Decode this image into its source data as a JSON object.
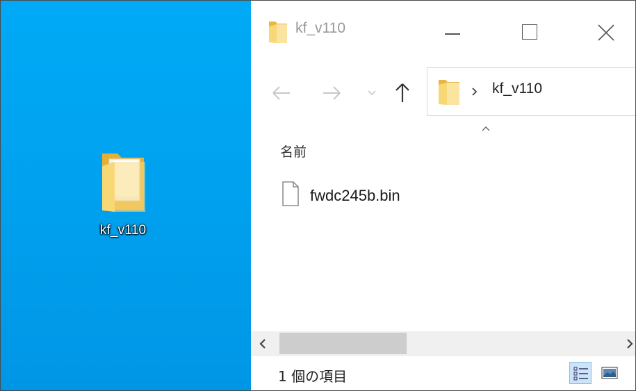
{
  "desktop": {
    "icon_label": "kf_v110",
    "background_color": "#00a2ef"
  },
  "window": {
    "title": "kf_v110",
    "controls": {
      "minimize_icon": "minimize-icon",
      "maximize_icon": "maximize-icon",
      "close_icon": "close-icon"
    }
  },
  "nav": {
    "back_icon": "arrow-left-icon",
    "forward_icon": "arrow-right-icon",
    "recent_icon": "chevron-down-icon",
    "up_icon": "arrow-up-icon",
    "address_path": "kf_v110"
  },
  "list": {
    "column_name": "名前",
    "files": [
      {
        "name": "fwdc245b.bin",
        "icon": "file-icon"
      }
    ]
  },
  "status": {
    "item_count": "1 個の項目",
    "views": [
      "details-view-icon",
      "large-icons-view-icon"
    ]
  },
  "colors": {
    "folder": "#f8d775",
    "folder_dark": "#e9b640",
    "selected_view": "#cce4f7"
  }
}
